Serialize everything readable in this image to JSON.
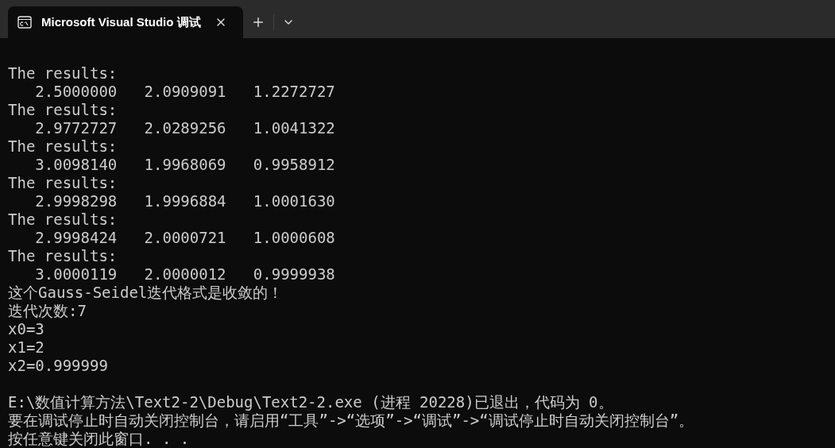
{
  "tab": {
    "title": "Microsoft Visual Studio 调试",
    "selected": true
  },
  "console": {
    "output_lines": [
      "The results:",
      "   2.5000000   2.0909091   1.2272727",
      "The results:",
      "   2.9772727   2.0289256   1.0041322",
      "The results:",
      "   3.0098140   1.9968069   0.9958912",
      "The results:",
      "   2.9998298   1.9996884   1.0001630",
      "The results:",
      "   2.9998424   2.0000721   1.0000608",
      "The results:",
      "   3.0000119   2.0000012   0.9999938",
      "这个Gauss-Seidel迭代格式是收敛的！",
      "迭代次数:7",
      "x0=3",
      "x1=2",
      "x2=0.999999"
    ],
    "exit_lines": [
      "E:\\数值计算方法\\Text2-2\\Debug\\Text2-2.exe (进程 20228)已退出，代码为 0。",
      "要在调试停止时自动关闭控制台，请启用“工具”->“选项”->“调试”->“调试停止时自动关闭控制台”。",
      "按任意键关闭此窗口. . ."
    ]
  }
}
